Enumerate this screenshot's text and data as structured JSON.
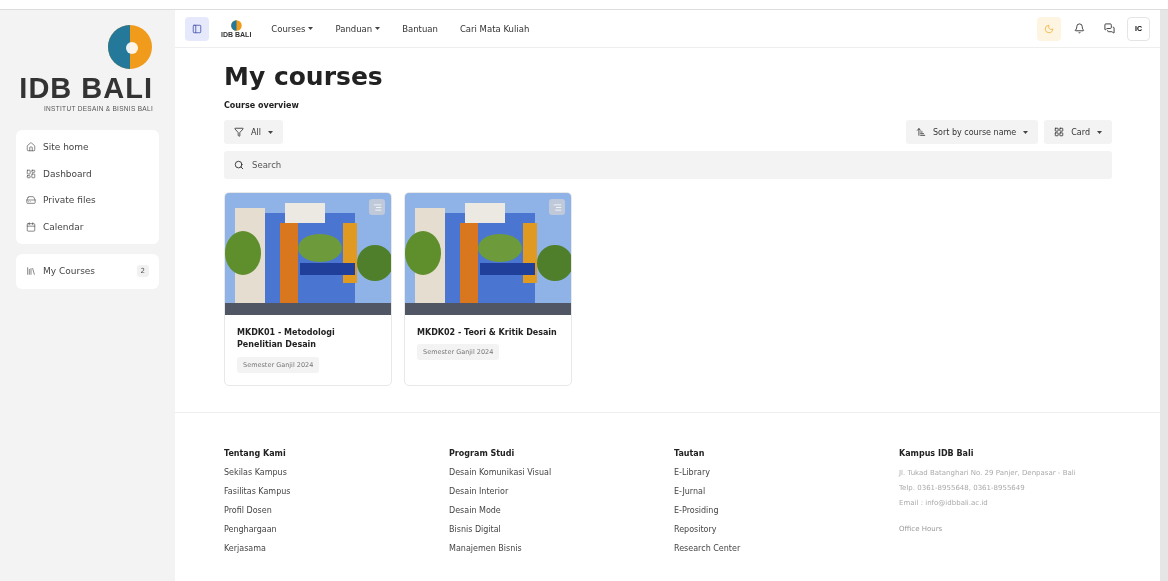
{
  "sidebar": {
    "logo": {
      "title": "IDB BALI",
      "subtitle": "INSTITUT DESAIN & BISNIS BALI"
    },
    "items": [
      {
        "label": "Site home"
      },
      {
        "label": "Dashboard"
      },
      {
        "label": "Private files"
      },
      {
        "label": "Calendar"
      }
    ],
    "my_courses": {
      "label": "My Courses",
      "count": "2"
    }
  },
  "topbar": {
    "logo_text": "IDB BALI",
    "menu": [
      {
        "label": "Courses",
        "dropdown": true
      },
      {
        "label": "Panduan",
        "dropdown": true
      },
      {
        "label": "Bantuan",
        "dropdown": false
      },
      {
        "label": "Cari Mata Kuliah",
        "dropdown": false
      }
    ],
    "avatar": "IC"
  },
  "page": {
    "title": "My courses",
    "subtitle": "Course overview",
    "filter": "All",
    "sort": "Sort by course name",
    "view": "Card",
    "search_placeholder": "Search"
  },
  "courses": [
    {
      "title": "MKDK01 - Metodologi Penelitian Desain",
      "kind": "picture",
      "tag": "Semester Ganjil 2024"
    },
    {
      "title": "MKDK02 - Teori & Kritik Desain",
      "kind": "picture",
      "tag": "Semester Ganjil 2024"
    }
  ],
  "footer": {
    "columns": [
      {
        "heading": "Tentang Kami",
        "links": [
          "Sekilas Kampus",
          "Fasilitas Kampus",
          "Profil Dosen",
          "Penghargaan",
          "Kerjasama"
        ]
      },
      {
        "heading": "Program Studi",
        "links": [
          "Desain Komunikasi Visual",
          "Desain Interior",
          "Desain Mode",
          "Bisnis Digital",
          "Manajemen Bisnis"
        ]
      },
      {
        "heading": "Tautan",
        "links": [
          "E-Library",
          "E-Jurnal",
          "E-Prosiding",
          "Repository",
          "Research Center"
        ]
      }
    ],
    "contact": {
      "heading": "Kampus IDB Bali",
      "lines": [
        "Jl. Tukad Batanghari No. 29 Panjer, Denpasar - Bali",
        "Telp. 0361-8955648, 0361-8955649",
        "Email : info@idbbali.ac.id"
      ],
      "hours": "Office Hours"
    }
  }
}
